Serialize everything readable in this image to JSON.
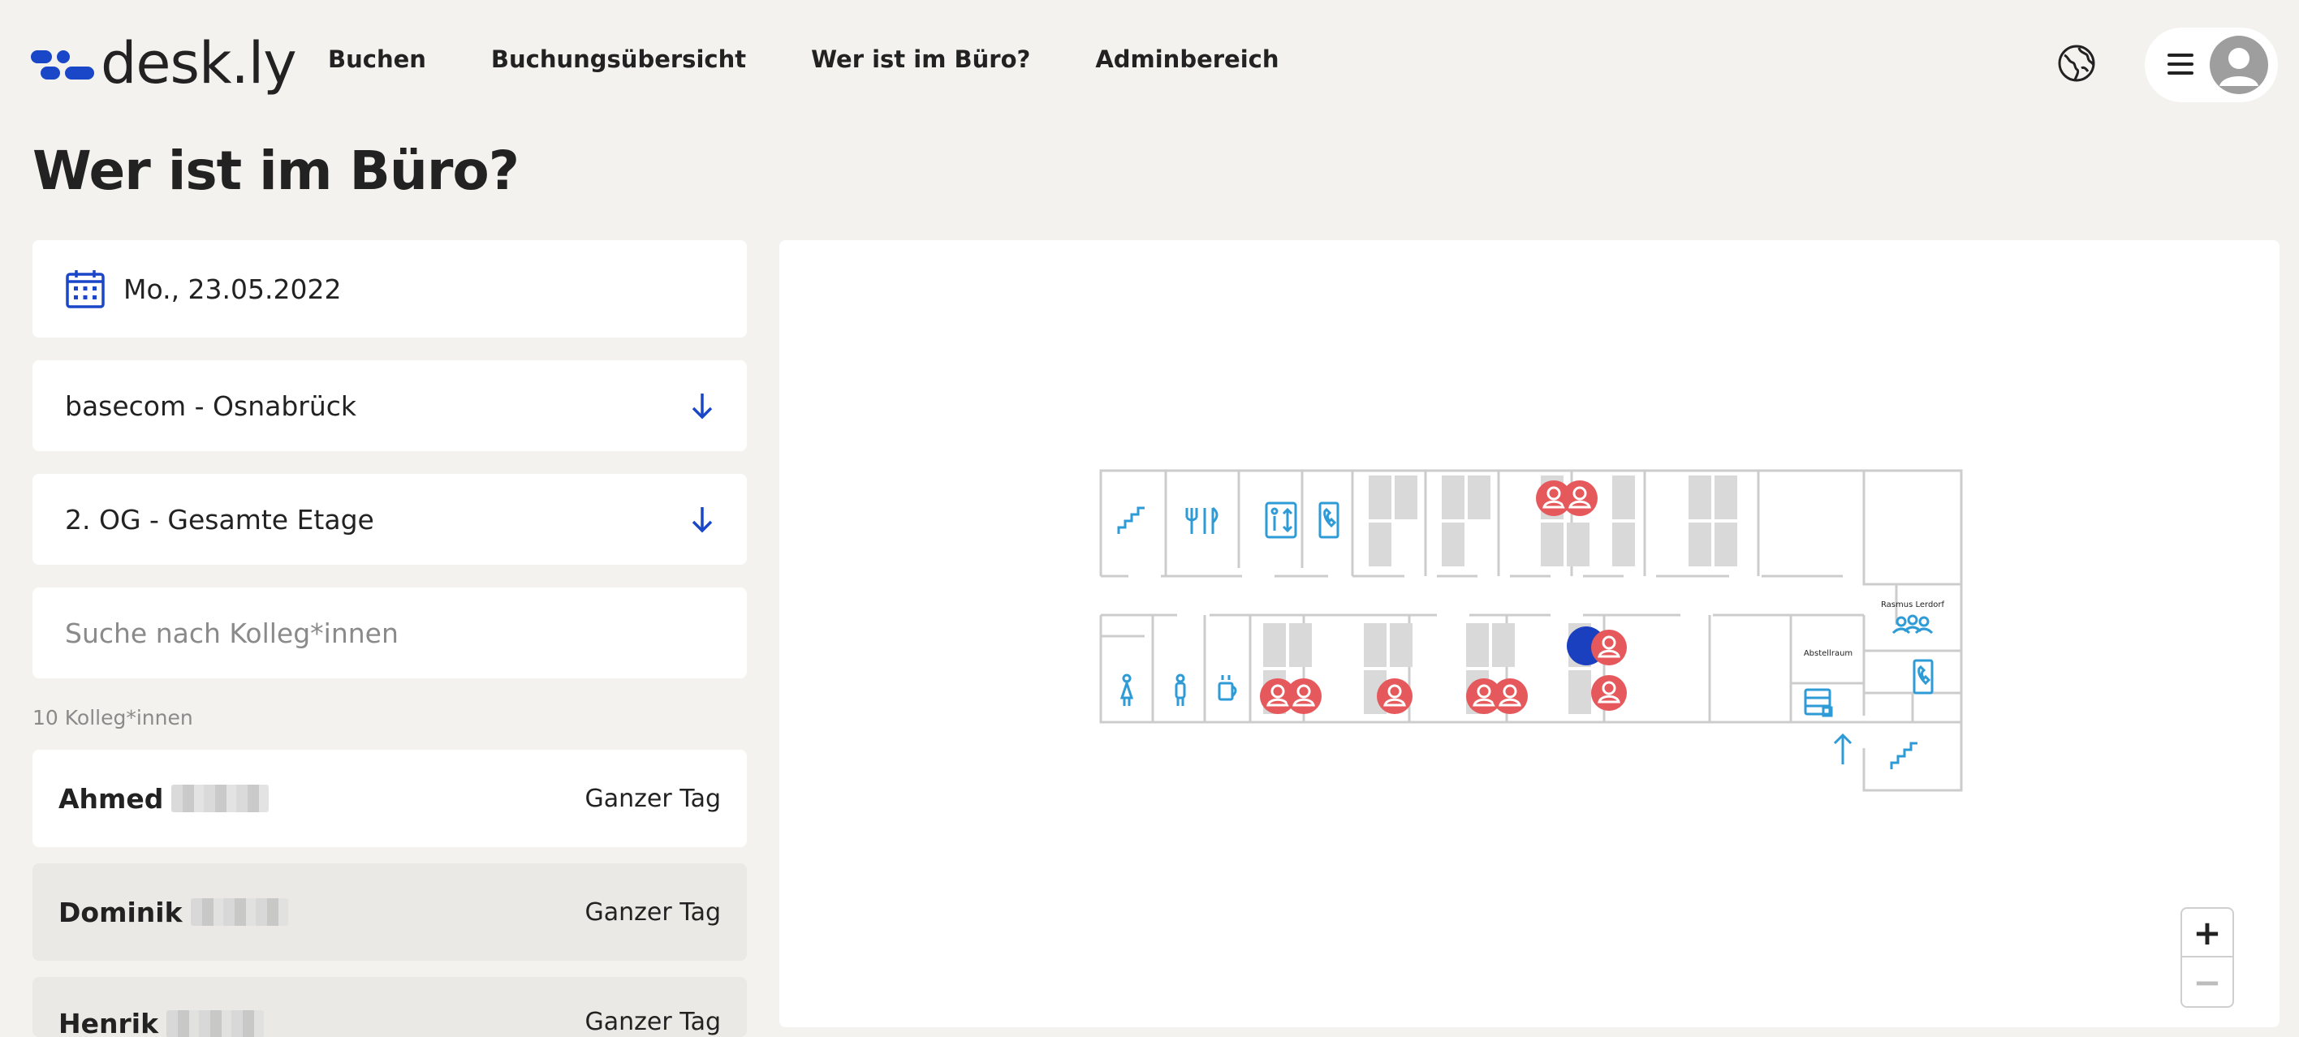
{
  "app": {
    "logo_text": "desk.ly",
    "brand_color": "#1a46c8"
  },
  "nav": {
    "items": [
      "Buchen",
      "Buchungsübersicht",
      "Wer ist im Büro?",
      "Adminbereich"
    ]
  },
  "header": {
    "icons": [
      "globe-icon",
      "hamburger-menu-icon",
      "user-avatar-icon"
    ]
  },
  "page": {
    "title": "Wer ist im Büro?"
  },
  "filters": {
    "date": "Mo., 23.05.2022",
    "location": "basecom - Osnabrück",
    "floor": "2. OG - Gesamte Etage",
    "search_placeholder": "Suche nach Kolleg*innen"
  },
  "colleagues": {
    "count_label": "10 Kolleg*innen",
    "items": [
      {
        "first_name": "Ahmed",
        "time": "Ganzer Tag"
      },
      {
        "first_name": "Dominik",
        "time": "Ganzer Tag"
      },
      {
        "first_name": "Henrik",
        "time": "Ganzer Tag"
      }
    ]
  },
  "map": {
    "room_labels": {
      "meeting_room": "Rasmus Lerdorf",
      "storage_room": "Abstellraum"
    },
    "zoom_in": "+",
    "zoom_out": "−",
    "colors": {
      "occupied": "#e5585b",
      "self": "#1a3fbf",
      "icon": "#2e9bd6",
      "desk": "#d9d9d9",
      "wall": "#cccccc"
    }
  }
}
